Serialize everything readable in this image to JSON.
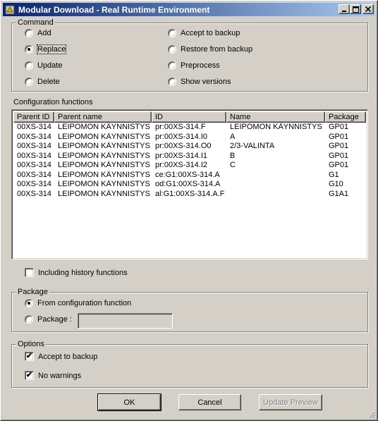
{
  "window": {
    "title": "Modular Download - Real Runtime Environment",
    "minimize": "_",
    "maximize": "□",
    "close": "×"
  },
  "command": {
    "label": "Command",
    "options": [
      {
        "label": "Add",
        "checked": false
      },
      {
        "label": "Replace",
        "checked": true
      },
      {
        "label": "Update",
        "checked": false
      },
      {
        "label": "Delete",
        "checked": false
      },
      {
        "label": "Accept to backup",
        "checked": false
      },
      {
        "label": "Restore from backup",
        "checked": false
      },
      {
        "label": "Preprocess",
        "checked": false
      },
      {
        "label": "Show versions",
        "checked": false
      }
    ]
  },
  "config": {
    "label": "Configuration functions",
    "columns": [
      "Parent ID",
      "Parent name",
      "ID",
      "Name",
      "Package"
    ],
    "rows": [
      [
        "00XS-314",
        "LEIPOMON KÄYNNISTYS",
        "pr:00XS-314.F",
        "LEIPOMON KÄYNNISTYS",
        "GP01"
      ],
      [
        "00XS-314",
        "LEIPOMON KÄYNNISTYS",
        "pr:00XS-314.I0",
        "A",
        "GP01"
      ],
      [
        "00XS-314",
        "LEIPOMON KÄYNNISTYS",
        "pr:00XS-314.O0",
        "2/3-VALINTA",
        "GP01"
      ],
      [
        "00XS-314",
        "LEIPOMON KÄYNNISTYS",
        "pr:00XS-314.I1",
        "B",
        "GP01"
      ],
      [
        "00XS-314",
        "LEIPOMON KÄYNNISTYS",
        "pr:00XS-314.I2",
        "C",
        "GP01"
      ],
      [
        "00XS-314",
        "LEIPOMON KÄYNNISTYS",
        "ce:G1:00XS-314.A",
        "",
        "G1"
      ],
      [
        "00XS-314",
        "LEIPOMON KÄYNNISTYS",
        "od:G1:00XS-314.A",
        "",
        "G10"
      ],
      [
        "00XS-314",
        "LEIPOMON KÄYNNISTYS",
        "al:G1:00XS-314.A.F",
        "",
        "G1A1"
      ]
    ],
    "history_label": "Including history functions",
    "history_checked": false
  },
  "package": {
    "label": "Package",
    "from_config_label": "From configuration function",
    "package_label": "Package :",
    "package_value": ""
  },
  "options": {
    "label": "Options",
    "accept_backup_label": "Accept to backup",
    "accept_backup_checked": true,
    "no_warnings_label": "No warnings",
    "no_warnings_checked": true
  },
  "buttons": {
    "ok": "OK",
    "cancel": "Cancel",
    "update_preview": "Update Preview"
  },
  "check_mark": "✔"
}
